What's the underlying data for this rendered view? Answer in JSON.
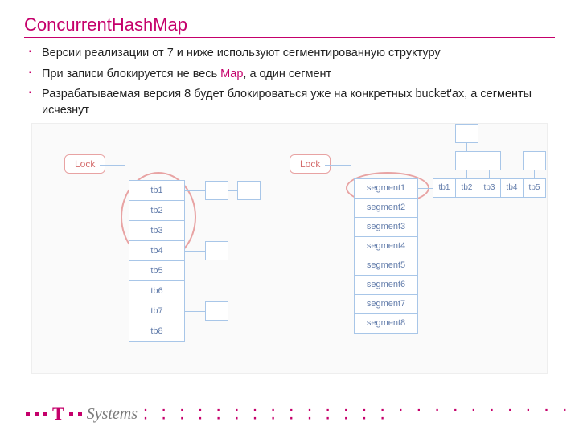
{
  "title": "ConcurrentHashMap",
  "bullets": {
    "b1": "Версии реализации от 7 и ниже используют сегментированную структуру",
    "b2_a": "При записи блокируется не весь ",
    "b2_hl": "Map",
    "b2_b": ", а один сегмент",
    "b3": "Разрабатываемая версия 8 будет блокироваться уже на конкретных bucket'ах, а сегменты исчезнут"
  },
  "diagram": {
    "lock": "Lock",
    "left": [
      "tb1",
      "tb2",
      "tb3",
      "tb4",
      "tb5",
      "tb6",
      "tb7",
      "tb8"
    ],
    "segments": [
      "segment1",
      "segment2",
      "segment3",
      "segment4",
      "segment5",
      "segment6",
      "segment7",
      "segment8"
    ],
    "tbs": [
      "tb1",
      "tb2",
      "tb3",
      "tb4",
      "tb5"
    ]
  },
  "footer": {
    "brand_t": "T",
    "brand_sys": "Systems",
    "dots": "· · · · · · · · · · · · · · · · · · · · · · · · · · · · · · · · · · · · · ·"
  }
}
